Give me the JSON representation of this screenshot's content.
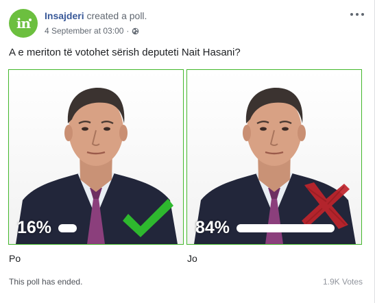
{
  "post": {
    "page_name": "Insajderi",
    "action": "created a poll.",
    "date": "4 September at 03:00",
    "separator": "·",
    "privacy_icon": "globe-icon",
    "avatar_text": "in",
    "avatar_color": "#6cbf3f",
    "more_icon": "more-options-icon"
  },
  "poll": {
    "question": "A e meriton të votohet sërish deputeti Nait Hasani?",
    "options": [
      {
        "label": "Po",
        "percent_text": "16%",
        "percent": 16,
        "mark_icon": "checkmark-icon",
        "mark_color": "#2eb82e"
      },
      {
        "label": "Jo",
        "percent_text": "84%",
        "percent": 84,
        "mark_icon": "cross-icon",
        "mark_color": "#c0242b"
      }
    ],
    "status": "This poll has ended.",
    "votes": "1.9K Votes",
    "border_color": "#42b72a"
  }
}
